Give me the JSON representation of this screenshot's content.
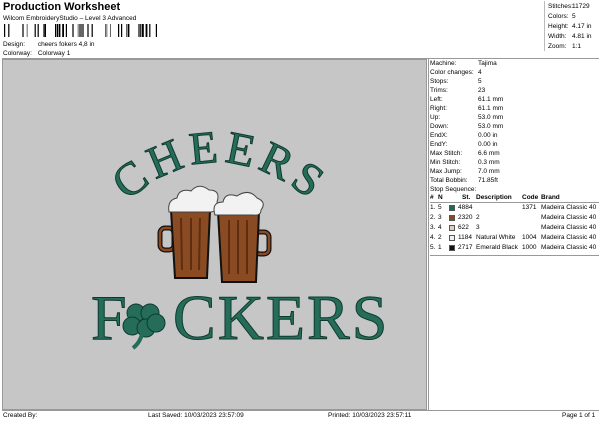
{
  "header": {
    "title": "Production Worksheet",
    "subtitle": "Wilcom EmbroideryStudio – Level 3 Advanced",
    "design_label": "Design:",
    "design_value": "cheers fokers 4,8 in",
    "colorway_label": "Colorway:",
    "colorway_value": "Colorway 1"
  },
  "stats": [
    {
      "label": "Stitches:",
      "value": "11729"
    },
    {
      "label": "Colors:",
      "value": "5"
    },
    {
      "label": "Height:",
      "value": "4.17 in"
    },
    {
      "label": "Width:",
      "value": "4.81 in"
    },
    {
      "label": "Zoom:",
      "value": "1:1"
    }
  ],
  "machine_info": [
    {
      "label": "Machine:",
      "value": "Tajima"
    },
    {
      "label": "Color changes:",
      "value": "4"
    },
    {
      "label": "Stops:",
      "value": "5"
    },
    {
      "label": "Trims:",
      "value": "23"
    },
    {
      "label": "Left:",
      "value": "61.1 mm"
    },
    {
      "label": "Right:",
      "value": "61.1 mm"
    },
    {
      "label": "Up:",
      "value": "53.0 mm"
    },
    {
      "label": "Down:",
      "value": "53.0 mm"
    },
    {
      "label": "EndX:",
      "value": "0.00 in"
    },
    {
      "label": "EndY:",
      "value": "0.00 in"
    },
    {
      "label": "Max Stitch:",
      "value": "6.6 mm"
    },
    {
      "label": "Min Stitch:",
      "value": "0.3 mm"
    },
    {
      "label": "Max Jump:",
      "value": "7.0 mm"
    },
    {
      "label": "Total Bobbin:",
      "value": "71.85ft"
    }
  ],
  "stop_sequence": {
    "title": "Stop Sequence:",
    "headers": {
      "num": "#",
      "n": "N",
      "st": "St.",
      "description": "Description",
      "code": "Code",
      "brand": "Brand"
    },
    "rows": [
      {
        "num": "1.",
        "n": "5",
        "color": "#1f6a57",
        "st": "4884",
        "description": "",
        "code": "1371",
        "brand": "Madeira Classic 40"
      },
      {
        "num": "2.",
        "n": "3",
        "color": "#8a4a22",
        "st": "2320",
        "description": "2",
        "code": "",
        "brand": "Madeira Classic 40"
      },
      {
        "num": "3.",
        "n": "4",
        "color": "#e8cbb8",
        "st": "622",
        "description": "3",
        "code": "",
        "brand": "Madeira Classic 40"
      },
      {
        "num": "4.",
        "n": "2",
        "color": "#f2f2f2",
        "st": "1184",
        "description": "Natural White",
        "code": "1004",
        "brand": "Madeira Classic 40"
      },
      {
        "num": "5.",
        "n": "1",
        "color": "#111111",
        "st": "2717",
        "description": "Emerald Black",
        "code": "1000",
        "brand": "Madeira Classic 40"
      }
    ]
  },
  "design_text": {
    "top_word": "CHEERS",
    "bottom_left": "F",
    "bottom_right": "CKERS"
  },
  "footer": {
    "created_by": "Created By:",
    "last_saved": "Last Saved:  10/03/2023 23:57:09",
    "printed": "Printed:  10/03/2023 23:57:11",
    "page": "Page 1 of 1"
  }
}
